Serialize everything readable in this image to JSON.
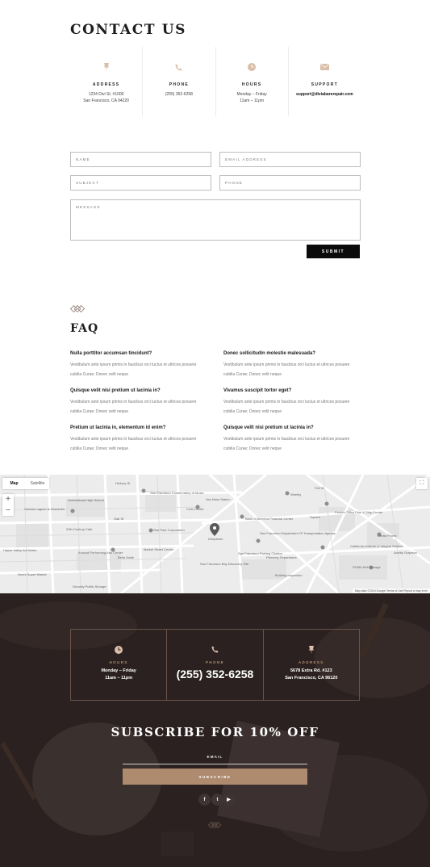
{
  "contact": {
    "title": "CONTACT US",
    "columns": [
      {
        "icon": "pin-icon",
        "label": "ADDRESS",
        "lines": [
          "1234 Divi St. #1000",
          "San Francisco, CA 94220"
        ]
      },
      {
        "icon": "phone-icon",
        "label": "PHONE",
        "lines": [
          "(255) 352-6258"
        ]
      },
      {
        "icon": "clock-icon",
        "label": "HOURS",
        "lines": [
          "Monday – Friday",
          "11am – 11pm"
        ]
      },
      {
        "icon": "envelope-icon",
        "label": "SUPPORT",
        "lines": [
          "support@diviabarerepair.com"
        ]
      }
    ]
  },
  "form": {
    "name_placeholder": "NAME",
    "email_placeholder": "EMAIL ADDRESS",
    "subject_placeholder": "SUBJECT",
    "phone_placeholder": "PHONE",
    "message_placeholder": "MESSAGE",
    "submit_label": "SUBMIT"
  },
  "faq": {
    "title": "FAQ",
    "items": [
      {
        "q": "Nulla porttitor accumsan tincidunt?",
        "a": "Vestibulum ante ipsum primis in faucibus orci luctus et ultrices posuere cubilia Curae; Donec velit neque"
      },
      {
        "q": "Donec sollicitudin molestie malesuada?",
        "a": "Vestibulum ante ipsum primis in faucibus orci luctus et ultrices posuere cubilia Curae; Donec velit neque"
      },
      {
        "q": "Quisque velit nisi pretium ut lacinia in?",
        "a": "Vestibulum ante ipsum primis in faucibus orci luctus et ultrices posuere cubilia Curae; Donec velit neque"
      },
      {
        "q": "Vivamus suscipit tortor eget?",
        "a": "Vestibulum ante ipsum primis in faucibus orci luctus et ultrices posuere cubilia Curae; Donec velit neque"
      },
      {
        "q": "Pretium ut lacinia in, elementum id enim?",
        "a": "Vestibulum ante ipsum primis in faucibus orci luctus et ultrices posuere cubilia Curae; Donec velit neque"
      },
      {
        "q": "Quisque velit nisi pretium ut lacinia in?",
        "a": "Vestibulum ante ipsum primis in faucibus orci luctus et ultrices posuere cubilia Curae; Donec velit neque"
      }
    ]
  },
  "map": {
    "type_map": "Map",
    "type_satellite": "Satellite",
    "zoom_in": "+",
    "zoom_out": "−",
    "labels": [
      "Hickory St",
      "San Francisco Conservatory of Music",
      "Van Ness Station",
      "Civic Center",
      "International High School",
      "Victoria Lagoon & Groceries",
      "Oak St",
      "20th Century Cafe",
      "Star Park Corporation",
      "Bank of America Financial Center",
      "Deeplearn",
      "San Francisco Department Of Transportation Agency",
      "Kendall Performing Arts Center",
      "Market Street Center",
      "San Francisco Parking Citation",
      "Planning Department",
      "Nick's Super Market",
      "Security Public Storage",
      "Fell St",
      "Weebly",
      "Square",
      "Urban Phone",
      "California Institute of Integral Studies",
      "SOMA Self Storage",
      "Acelity Graphics",
      "Hayes Valley Art Works",
      "Bella Smile",
      "San Francisco Bay Discovery Site",
      "Building Inspection",
      "Ferries Office Print & Ship Center"
    ],
    "footer": "Map data ©2024 Google   Terms of Use   Report a map error"
  },
  "footer": {
    "columns": [
      {
        "icon": "clock-icon",
        "label": "HOURS",
        "lines": [
          "Monday – Friday",
          "11am – 11pm"
        ]
      },
      {
        "icon": "phone-icon",
        "label": "PHONE",
        "big": "(255) 352-6258"
      },
      {
        "icon": "pin-icon",
        "label": "ADDRESS",
        "lines": [
          "5678 Extra Rd. #123",
          "San Francisco, CA 96120"
        ]
      }
    ],
    "subscribe_title": "SUBSCRIBE FOR 10% OFF",
    "email_label": "EMAIL",
    "subscribe_label": "SUBSCRIBE",
    "social": [
      {
        "icon": "facebook-icon",
        "glyph": "f"
      },
      {
        "icon": "twitter-icon",
        "glyph": "t"
      },
      {
        "icon": "youtube-icon",
        "glyph": "▶"
      }
    ]
  },
  "colors": {
    "accent": "#b58c6d",
    "button_accent": "#ae8a6e",
    "footer_bg": "#2b2221",
    "icon_tan": "#d9bfa9"
  }
}
